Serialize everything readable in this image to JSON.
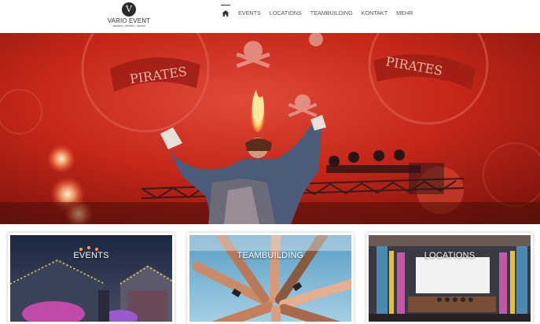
{
  "brand": {
    "logo_letter": "V",
    "name": "VARIO EVENT",
    "tagline": "variabel • flexibel • überall"
  },
  "nav": {
    "items": [
      {
        "label": "",
        "icon": "home-icon",
        "active": true
      },
      {
        "label": "EVENTS"
      },
      {
        "label": "LOCATIONS"
      },
      {
        "label": "TEAMBUILDING"
      },
      {
        "label": "KONTAKT"
      },
      {
        "label": "MEHR"
      }
    ]
  },
  "hero": {
    "banner_text": [
      "PIRATES",
      "PIRATES"
    ]
  },
  "cards": [
    {
      "title": "EVENTS"
    },
    {
      "title": "TEAMBUILDING"
    },
    {
      "title": "LOCATIONS"
    }
  ],
  "colors": {
    "hero_red": "#c7231a",
    "nav_text": "#555555"
  }
}
